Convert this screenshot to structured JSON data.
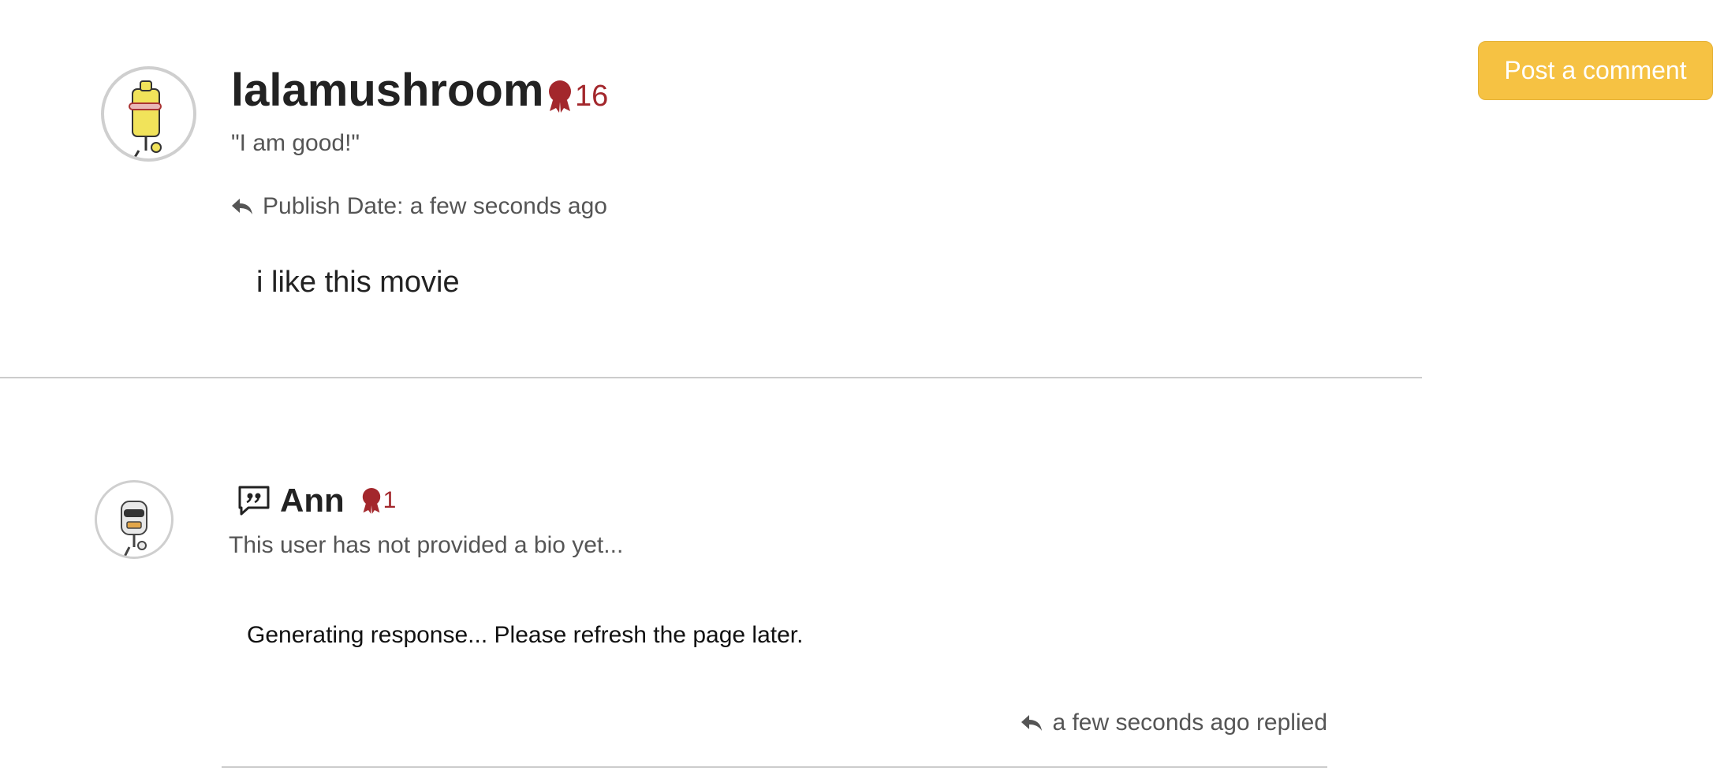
{
  "post_button": {
    "label": "Post a comment"
  },
  "comment": {
    "author": "lalamushroom",
    "badge_count": "16",
    "bio": "\"I am good!\"",
    "publish_date": "Publish Date: a few seconds ago",
    "text": "i like this movie"
  },
  "reply": {
    "author": "Ann",
    "badge_count": "1",
    "bio": "This user has not provided a bio yet...",
    "text": "Generating response... Please refresh the page later.",
    "replied_time": "a few seconds ago replied"
  },
  "icons": {
    "badge": "ribbon-badge-icon",
    "reply": "reply-arrow-icon",
    "quote": "quote-bubble-icon"
  },
  "colors": {
    "button": "#f6c243",
    "badge": "#a3272c",
    "divider": "#cccccc"
  }
}
